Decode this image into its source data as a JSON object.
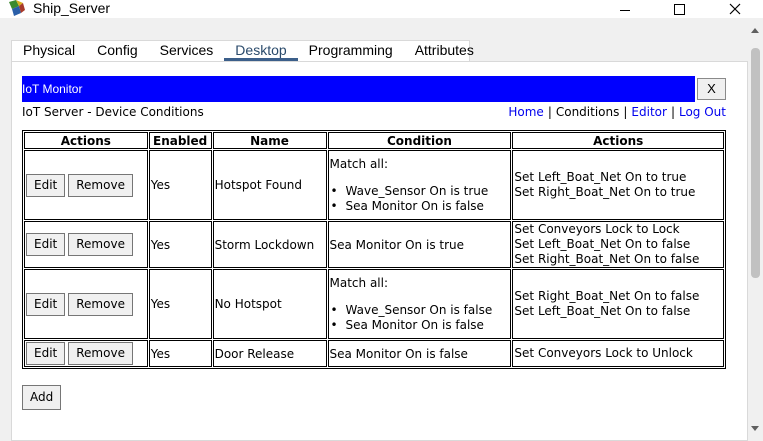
{
  "window": {
    "title": "Ship_Server",
    "icon": "packet-tracer-server-icon"
  },
  "tabs": [
    {
      "label": "Physical",
      "active": false
    },
    {
      "label": "Config",
      "active": false
    },
    {
      "label": "Services",
      "active": false
    },
    {
      "label": "Desktop",
      "active": true
    },
    {
      "label": "Programming",
      "active": false
    },
    {
      "label": "Attributes",
      "active": false
    }
  ],
  "panel": {
    "title": "IoT Monitor",
    "close_label": "X",
    "subheader": "IoT Server - Device Conditions",
    "nav": {
      "home": "Home",
      "conditions": "Conditions",
      "editor": "Editor",
      "logout": "Log Out",
      "separator": "|"
    }
  },
  "table": {
    "headers": [
      "Actions",
      "Enabled",
      "Name",
      "Condition",
      "Actions"
    ],
    "edit_label": "Edit",
    "remove_label": "Remove",
    "rows": [
      {
        "enabled": "Yes",
        "name": "Hotspot Found",
        "condition_header": "Match all:",
        "conditions": [
          "Wave_Sensor On is true",
          "Sea Monitor On is false"
        ],
        "actions": [
          "Set Left_Boat_Net On to true",
          "Set Right_Boat_Net On to true"
        ]
      },
      {
        "enabled": "Yes",
        "name": "Storm Lockdown",
        "condition": "Sea Monitor On is true",
        "actions": [
          "Set Conveyors Lock to Lock",
          "Set Left_Boat_Net On to false",
          "Set Right_Boat_Net On to false"
        ]
      },
      {
        "enabled": "Yes",
        "name": "No Hotspot",
        "condition_header": "Match all:",
        "conditions": [
          "Wave_Sensor On is false",
          "Sea Monitor On is false"
        ],
        "actions": [
          "Set Right_Boat_Net On to false",
          "Set Left_Boat_Net On to false"
        ]
      },
      {
        "enabled": "Yes",
        "name": "Door Release",
        "condition": "Sea Monitor On is false",
        "actions": [
          "Set Conveyors Lock to Unlock"
        ]
      }
    ]
  },
  "add_label": "Add",
  "colors": {
    "header_blue": "#0000ff",
    "link": "#0000ee",
    "active_tab_underline": "#3c5f8a"
  }
}
